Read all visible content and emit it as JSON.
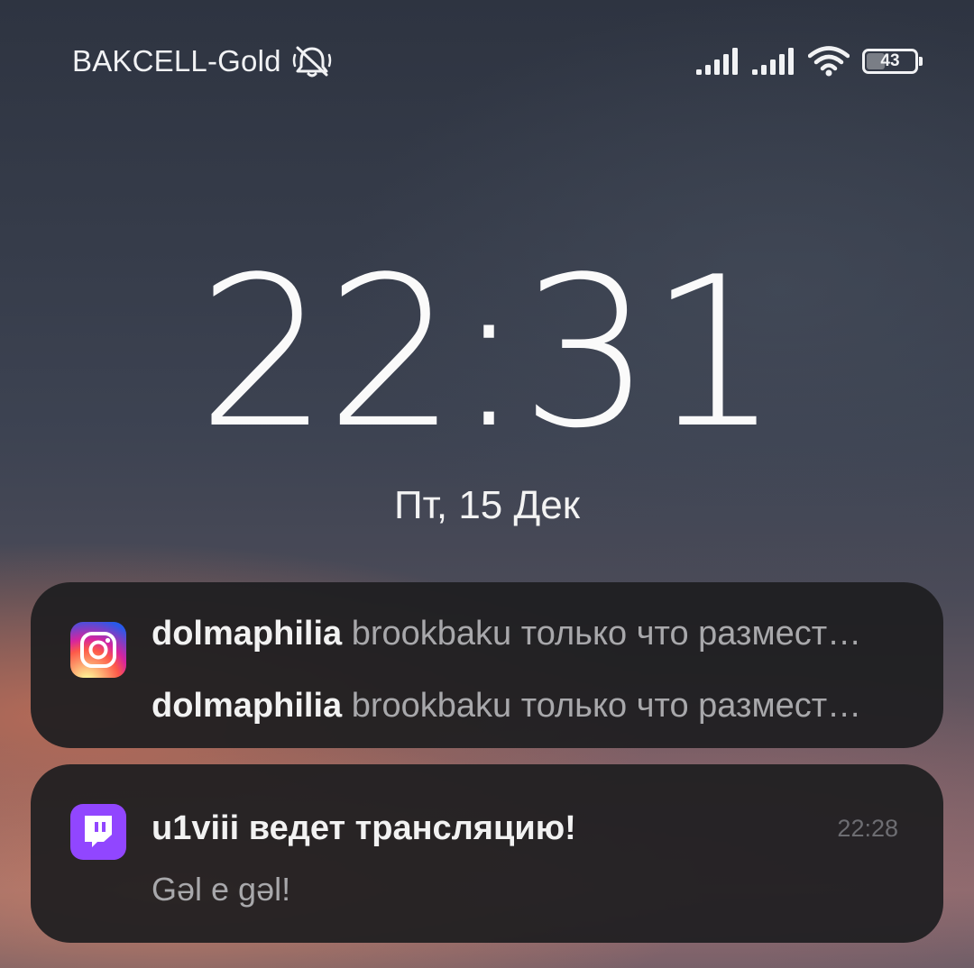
{
  "status_bar": {
    "carrier": "BAKCELL-Gold",
    "battery_level": "43",
    "battery_fraction": 0.43,
    "icons": [
      "mute-bell-icon",
      "signal-icon",
      "signal-icon",
      "wifi-icon",
      "battery-icon"
    ]
  },
  "lockscreen": {
    "time": "22:31",
    "date": "Пт, 15 Дек"
  },
  "notifications": [
    {
      "app": "instagram",
      "icon": "instagram-icon",
      "lines": [
        {
          "sender": "dolmaphilia",
          "message": "brookbaku только что размест…"
        },
        {
          "sender": "dolmaphilia",
          "message": "brookbaku только что размест…"
        }
      ]
    },
    {
      "app": "twitch",
      "icon": "twitch-icon",
      "title": "u1viii ведет трансляцию!",
      "time": "22:28",
      "body": "Gəl e gəl!"
    }
  ],
  "colors": {
    "instagram_gradient": [
      "#fdf497",
      "#fd5949",
      "#d6249f",
      "#285AEB"
    ],
    "twitch_purple": "#9146ff",
    "card_bg": "#1e1e20"
  }
}
